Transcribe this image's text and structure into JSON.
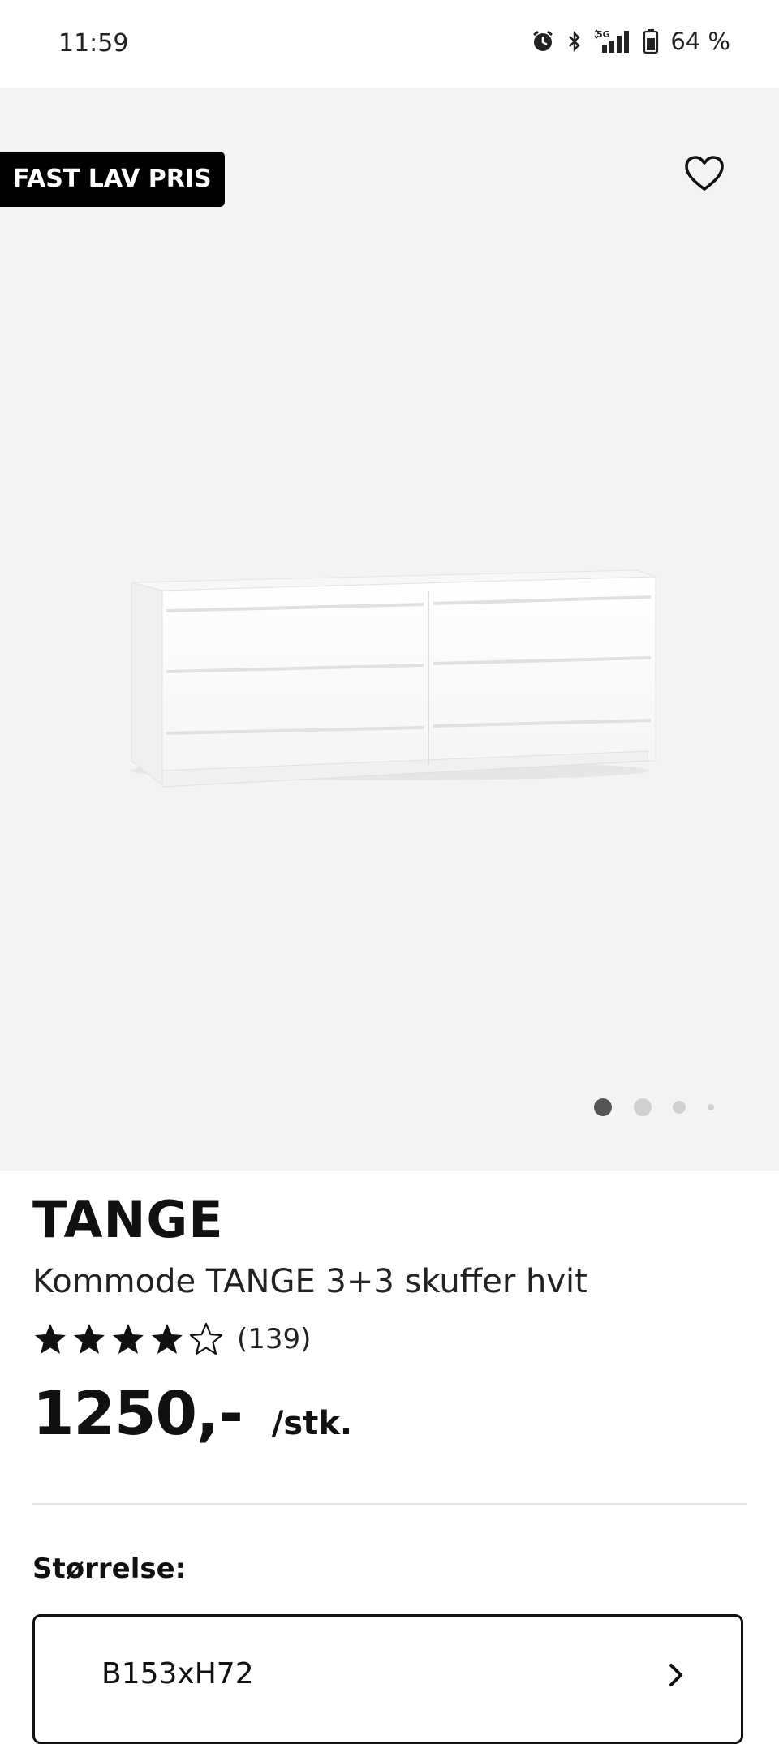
{
  "status_bar": {
    "time": "11:59",
    "network": "5G",
    "battery": "64 %",
    "icons": [
      "alarm-icon",
      "bluetooth-icon",
      "signal-icon",
      "battery-icon"
    ]
  },
  "hero": {
    "badge": "FAST LAV PRIS",
    "favorite_icon": "heart-outline-icon",
    "image": "white-dresser-3+3-drawers",
    "carousel": {
      "total": 4,
      "active_index": 0
    }
  },
  "product": {
    "brand": "TANGE",
    "name": "Kommode TANGE 3+3 skuffer hvit",
    "rating": {
      "value": 4,
      "max": 5,
      "count": "(139)"
    },
    "price": "1250,-",
    "unit": "/stk."
  },
  "size": {
    "label": "Størrelse:",
    "selected": "B153xH72",
    "icon": "chevron-right-icon"
  },
  "colors": {
    "hero_bg": "#f3f3f3",
    "badge_bg": "#000000",
    "dot_active": "#555555",
    "dot_inactive": "#d0d0d0"
  }
}
